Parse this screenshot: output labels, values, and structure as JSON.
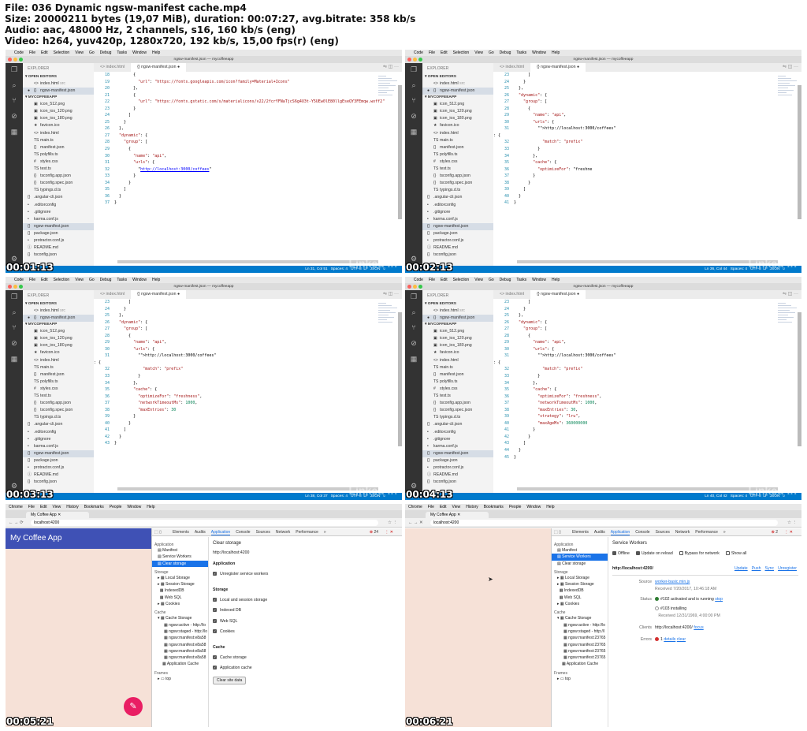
{
  "header": {
    "line1": "File: 036 Dynamic ngsw-manifest cache.mp4",
    "line2": "Size: 20000211 bytes (19,07 MiB), duration: 00:07:27, avg.bitrate: 358 kb/s",
    "line3": "Audio: aac, 48000 Hz, 2 channels, s16, 160 kb/s (eng)",
    "line4": "Video: h264, yuv420p, 1280x720, 192 kb/s, 15,00 fps(r) (eng)"
  },
  "watermark": "Linked in",
  "vscode": {
    "menu": [
      "Code",
      "File",
      "Edit",
      "Selection",
      "View",
      "Go",
      "Debug",
      "Tasks",
      "Window",
      "Help"
    ],
    "window_title": "ngsw-manifest.json — mycoffeeapp",
    "explorer_title": "EXPLORER",
    "open_editors": "OPEN EDITORS",
    "open_editors_badge": "1 UNSAVED",
    "project": "MYCOFFEEAPP",
    "open_files": [
      {
        "name": "index.html",
        "note": "src"
      },
      {
        "name": "ngsw-manifest.json",
        "note": ""
      }
    ],
    "files": [
      "icon_512.png",
      "icon_ios_120.png",
      "icon_ios_180.png",
      "favicon.ico",
      "index.html",
      "main.ts",
      "manifest.json",
      "polyfills.ts",
      "styles.css",
      "test.ts",
      "tsconfig.app.json",
      "tsconfig.spec.json",
      "typings.d.ts",
      ".angular-cli.json",
      ".editorconfig",
      ".gitignore",
      "karma.conf.js",
      "ngsw-manifest.json",
      "package.json",
      "protractor.conf.js",
      "README.md",
      "tsconfig.json"
    ],
    "tab1": "index.html",
    "tab2": "ngsw-manifest.json"
  },
  "frames": [
    {
      "timestamp": "00:01:13",
      "status_pos": "Ln 31, Col 51",
      "spaces": "Spaces: 4",
      "encoding": "UTF-8",
      "lf": "LF",
      "lang": "JSON",
      "start": 18,
      "lines": [
        "        {",
        "          \"url\": \"https://fonts.googleapis.com/icon?family=Material+Icons\"",
        "        },",
        "        {",
        "          \"url\": \"https://fonts.gstatic.com/s/materialicons/v22/2fcrYFNaTjcS6g4U3t-Y5UEw0lE80llgEseQY3FEmqw.woff2\"",
        "        }",
        "      ]",
        "    }",
        "  },",
        "  \"dynamic\": {",
        "    \"group\": [",
        "      {",
        "        \"name\": \"api\",",
        "        \"urls\": {",
        "          \"http://localhost:3000/coffees\"",
        "        }",
        "      }",
        "    ]",
        "  }",
        "}"
      ]
    },
    {
      "timestamp": "00:02:13",
      "status_pos": "Ln 36, Col 44",
      "spaces": "Spaces: 4",
      "encoding": "UTF-8",
      "lf": "LF",
      "lang": "JSON",
      "start": 23,
      "lines": [
        "      ]",
        "    }",
        "  },",
        "  \"dynamic\": {",
        "    \"group\": [",
        "      {",
        "        \"name\": \"api\",",
        "        \"urls\": {",
        "          \"http://localhost:3000/coffees\": {",
        "            \"match\": \"prefix\"",
        "          }",
        "        },",
        "        \"cache\": {",
        "          \"optimizeFor\": \"freshne",
        "        }",
        "      }",
        "    ]",
        "  }",
        "}"
      ]
    },
    {
      "timestamp": "00:03:13",
      "status_pos": "Ln 38, Col 37",
      "spaces": "Spaces: 4",
      "encoding": "UTF-8",
      "lf": "LF",
      "lang": "JSON",
      "start": 23,
      "lines": [
        "      ]",
        "    }",
        "  },",
        "  \"dynamic\": {",
        "    \"group\": [",
        "      {",
        "        \"name\": \"api\",",
        "        \"urls\": {",
        "          \"http://localhost:3000/coffees\": {",
        "            \"match\": \"prefix\"",
        "          }",
        "        },",
        "        \"cache\": {",
        "          \"optimizeFor\": \"freshness\",",
        "          \"networkTimeoutMs\": 1000,",
        "          \"maxEntries\": 30",
        "        }",
        "      }",
        "    ]",
        "  }",
        "}"
      ]
    },
    {
      "timestamp": "00:04:13",
      "status_pos": "Ln 40, Col 42",
      "spaces": "Spaces: 4",
      "encoding": "UTF-8",
      "lf": "LF",
      "lang": "JSON",
      "start": 23,
      "lines": [
        "      ]",
        "    }",
        "  },",
        "  \"dynamic\": {",
        "    \"group\": [",
        "      {",
        "        \"name\": \"api\",",
        "        \"urls\": {",
        "          \"http://localhost:3000/coffees\": {",
        "            \"match\": \"prefix\"",
        "          }",
        "        },",
        "        \"cache\": {",
        "          \"optimizeFor\": \"freshness\",",
        "          \"networkTimeoutMs\": 1000,",
        "          \"maxEntries\": 30,",
        "          \"strategy\": \"lru\",",
        "          \"maxAgeMs\": 360000000",
        "        }",
        "      }",
        "    ]",
        "  }",
        "}"
      ]
    }
  ],
  "chrome": {
    "menu": [
      "Chrome",
      "File",
      "Edit",
      "View",
      "History",
      "Bookmarks",
      "People",
      "Window",
      "Help"
    ],
    "tab_title": "My Coffee App",
    "url": "localhost:4200",
    "app_title": "My Coffee App",
    "fab_icon": "✎",
    "devtools_tabs": [
      "Elements",
      "Audits",
      "Application",
      "Console",
      "Sources",
      "Network",
      "Performance",
      "»"
    ],
    "side": {
      "app_group": "Application",
      "app_items": [
        "Manifest",
        "Service Workers",
        "Clear storage"
      ],
      "storage_group": "Storage",
      "storage_items": [
        "Local Storage",
        "Session Storage",
        "IndexedDB",
        "Web SQL",
        "Cookies"
      ],
      "cache_group": "Cache",
      "cache_storage": "Cache Storage",
      "cache_items": [
        "ngsw:active - http://lo",
        "ngsw:staged - http://lo",
        "ngsw:manifest:e8a58",
        "ngsw:manifest:e8a58",
        "ngsw:manifest:e8a58",
        "ngsw:manifest:e8a58"
      ],
      "cache_items_b": [
        "ngsw:active - http://lo",
        "ngsw:staged - http://l",
        "ngsw:manifest:23765",
        "ngsw:manifest:23765",
        "ngsw:manifest:23765",
        "ngsw:manifest:23765"
      ],
      "app_cache": "Application Cache",
      "frames_group": "Frames",
      "top": "top"
    },
    "clear": {
      "timestamp": "00:05:21",
      "errors": "24",
      "title": "Clear storage",
      "origin": "http://localhost:4200",
      "app_h": "Application",
      "app_opt": "Unregister service workers",
      "storage_h": "Storage",
      "storage_opts": [
        "Local and session storage",
        "Indexed DB",
        "Web SQL",
        "Cookies"
      ],
      "cache_h": "Cache",
      "cache_opts": [
        "Cache storage",
        "Application cache"
      ],
      "button": "Clear site data"
    },
    "sw": {
      "timestamp": "00:06:21",
      "errors": "2",
      "title": "Service Workers",
      "opts": [
        "Offline",
        "Update on reload",
        "Bypass for network",
        "Show all"
      ],
      "scope": "http://localhost:4200/",
      "actions": [
        "Update",
        "Push",
        "Sync",
        "Unregister"
      ],
      "source_label": "Source",
      "source": "worker-basic.min.js",
      "received": "Received 7/20/2017, 10:46:18 AM",
      "status_label": "Status",
      "status1": "#102 activated and is running",
      "stop": "stop",
      "status2": "#103 installing",
      "received2": "Received 12/31/1969, 4:00:00 PM",
      "clients_label": "Clients",
      "clients": "http://localhost:4200/",
      "focus": "focus",
      "errors_label": "Errors",
      "err_count": "1",
      "details": "details",
      "clear": "clear"
    }
  }
}
